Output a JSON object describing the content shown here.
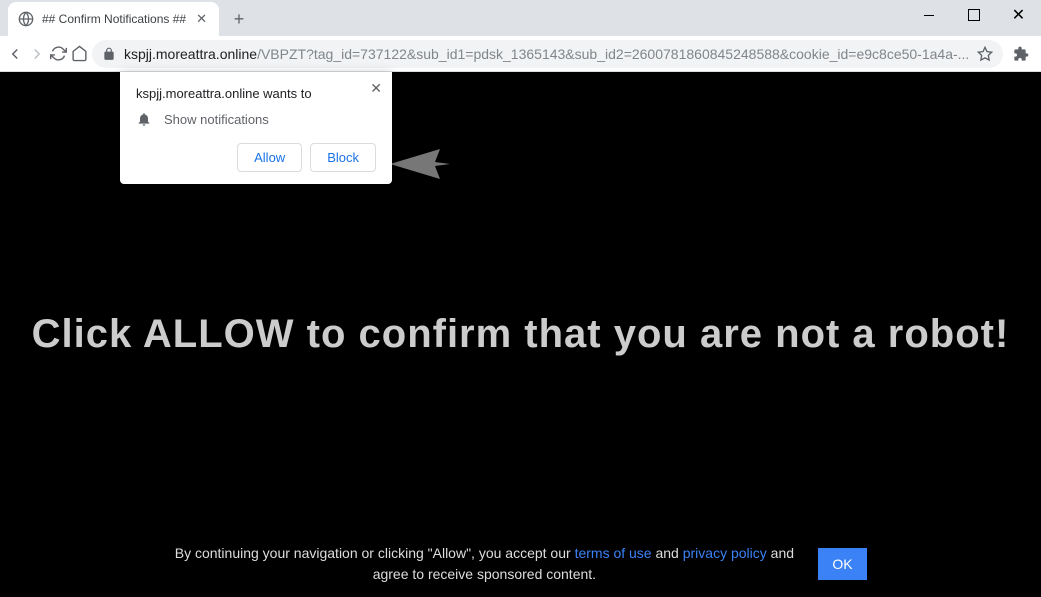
{
  "window": {
    "tab_title": "## Confirm Notifications ##"
  },
  "addressbar": {
    "url_host": "kspjj.moreattra.online",
    "url_path": "/VBPZT?tag_id=737122&sub_id1=pdsk_1365143&sub_id2=2600781860845248588&cookie_id=e9c8ce50-1a4a-..."
  },
  "permission_prompt": {
    "origin_text": "kspjj.moreattra.online wants to",
    "permission_label": "Show notifications",
    "allow_label": "Allow",
    "block_label": "Block"
  },
  "page": {
    "headline": "Click ALLOW to confirm that you are not a robot!"
  },
  "cookiebar": {
    "text_before": "By continuing your navigation or clicking \"Allow\", you accept our ",
    "terms_label": "terms of use",
    "and1": " and ",
    "privacy_label": "privacy policy",
    "text_after": " and agree to receive sponsored content.",
    "ok_label": "OK"
  }
}
